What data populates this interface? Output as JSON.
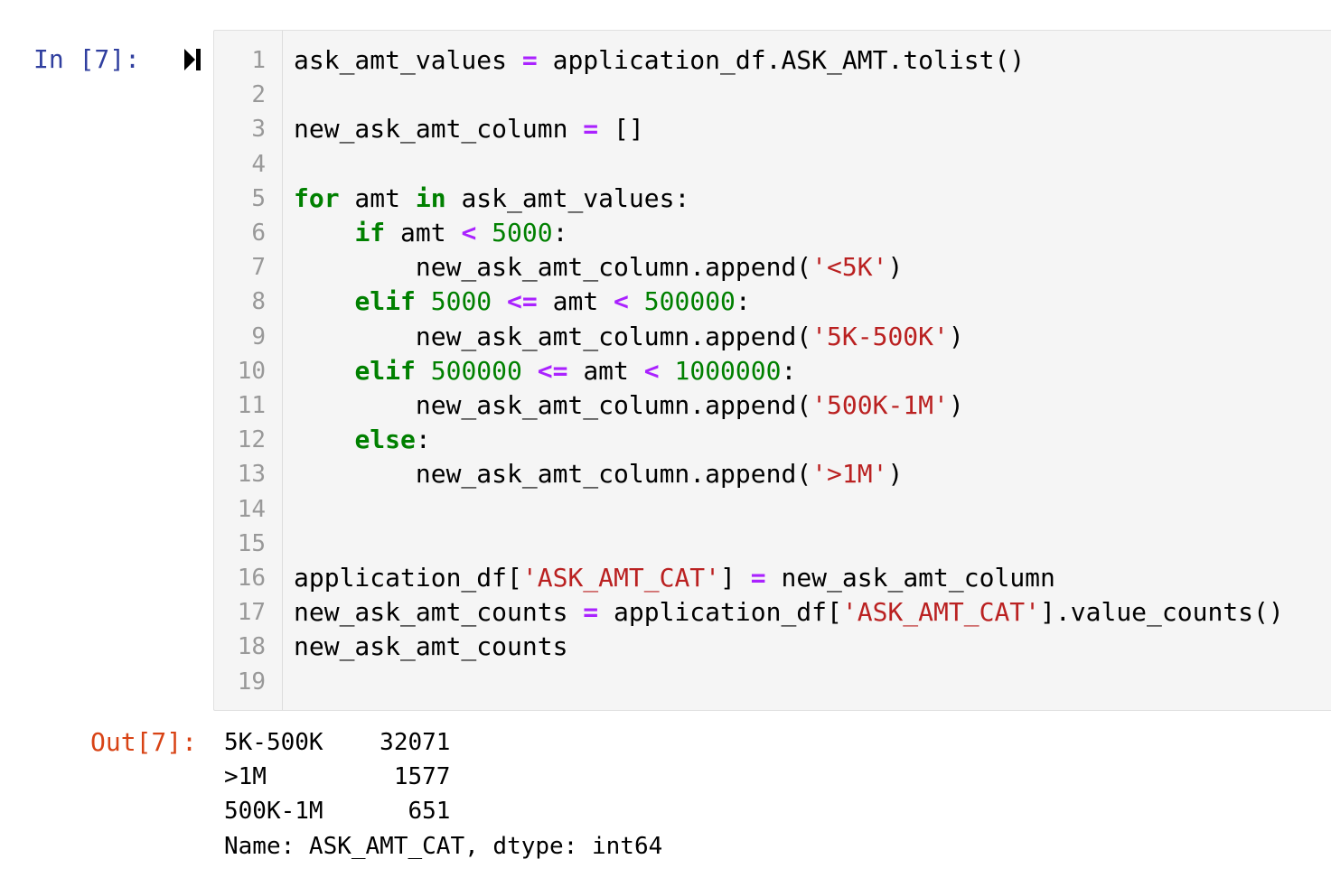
{
  "cell": {
    "in_prompt": "In [7]:",
    "out_prompt": "Out[7]:",
    "run_icon": "run-cell-icon",
    "line_numbers": [
      "1",
      "2",
      "3",
      "4",
      "5",
      "6",
      "7",
      "8",
      "9",
      "10",
      "11",
      "12",
      "13",
      "14",
      "15",
      "16",
      "17",
      "18",
      "19"
    ],
    "code_lines": [
      [
        {
          "t": "t",
          "v": "ask_amt_values "
        },
        {
          "t": "op",
          "v": "="
        },
        {
          "t": "t",
          "v": " application_df.ASK_AMT.tolist()"
        }
      ],
      [],
      [
        {
          "t": "t",
          "v": "new_ask_amt_column "
        },
        {
          "t": "op",
          "v": "="
        },
        {
          "t": "t",
          "v": " []"
        }
      ],
      [],
      [
        {
          "t": "kw",
          "v": "for"
        },
        {
          "t": "t",
          "v": " amt "
        },
        {
          "t": "kw",
          "v": "in"
        },
        {
          "t": "t",
          "v": " ask_amt_values:"
        }
      ],
      [
        {
          "t": "t",
          "v": "    "
        },
        {
          "t": "kw",
          "v": "if"
        },
        {
          "t": "t",
          "v": " amt "
        },
        {
          "t": "op",
          "v": "<"
        },
        {
          "t": "t",
          "v": " "
        },
        {
          "t": "num",
          "v": "5000"
        },
        {
          "t": "t",
          "v": ":"
        }
      ],
      [
        {
          "t": "t",
          "v": "        new_ask_amt_column.append("
        },
        {
          "t": "str",
          "v": "'<5K'"
        },
        {
          "t": "t",
          "v": ")"
        }
      ],
      [
        {
          "t": "t",
          "v": "    "
        },
        {
          "t": "kw",
          "v": "elif"
        },
        {
          "t": "t",
          "v": " "
        },
        {
          "t": "num",
          "v": "5000"
        },
        {
          "t": "t",
          "v": " "
        },
        {
          "t": "op",
          "v": "<="
        },
        {
          "t": "t",
          "v": " amt "
        },
        {
          "t": "op",
          "v": "<"
        },
        {
          "t": "t",
          "v": " "
        },
        {
          "t": "num",
          "v": "500000"
        },
        {
          "t": "t",
          "v": ":"
        }
      ],
      [
        {
          "t": "t",
          "v": "        new_ask_amt_column.append("
        },
        {
          "t": "str",
          "v": "'5K-500K'"
        },
        {
          "t": "t",
          "v": ")"
        }
      ],
      [
        {
          "t": "t",
          "v": "    "
        },
        {
          "t": "kw",
          "v": "elif"
        },
        {
          "t": "t",
          "v": " "
        },
        {
          "t": "num",
          "v": "500000"
        },
        {
          "t": "t",
          "v": " "
        },
        {
          "t": "op",
          "v": "<="
        },
        {
          "t": "t",
          "v": " amt "
        },
        {
          "t": "op",
          "v": "<"
        },
        {
          "t": "t",
          "v": " "
        },
        {
          "t": "num",
          "v": "1000000"
        },
        {
          "t": "t",
          "v": ":"
        }
      ],
      [
        {
          "t": "t",
          "v": "        new_ask_amt_column.append("
        },
        {
          "t": "str",
          "v": "'500K-1M'"
        },
        {
          "t": "t",
          "v": ")"
        }
      ],
      [
        {
          "t": "t",
          "v": "    "
        },
        {
          "t": "kw",
          "v": "else"
        },
        {
          "t": "t",
          "v": ":"
        }
      ],
      [
        {
          "t": "t",
          "v": "        new_ask_amt_column.append("
        },
        {
          "t": "str",
          "v": "'>1M'"
        },
        {
          "t": "t",
          "v": ")"
        }
      ],
      [],
      [],
      [
        {
          "t": "t",
          "v": "application_df["
        },
        {
          "t": "str",
          "v": "'ASK_AMT_CAT'"
        },
        {
          "t": "t",
          "v": "] "
        },
        {
          "t": "op",
          "v": "="
        },
        {
          "t": "t",
          "v": " new_ask_amt_column"
        }
      ],
      [
        {
          "t": "t",
          "v": "new_ask_amt_counts "
        },
        {
          "t": "op",
          "v": "="
        },
        {
          "t": "t",
          "v": " application_df["
        },
        {
          "t": "str",
          "v": "'ASK_AMT_CAT'"
        },
        {
          "t": "t",
          "v": "].value_counts()"
        }
      ],
      [
        {
          "t": "t",
          "v": "new_ask_amt_counts"
        }
      ],
      []
    ],
    "output_lines": [
      "5K-500K    32071",
      ">1M         1577",
      "500K-1M      651",
      "Name: ASK_AMT_CAT, dtype: int64"
    ]
  },
  "colors": {
    "in_prompt": "#303f9f",
    "out_prompt": "#d84315",
    "keyword": "#008000",
    "operator": "#aa22ff",
    "number": "#008000",
    "string": "#ba2121",
    "code_bg": "#f5f5f5"
  }
}
